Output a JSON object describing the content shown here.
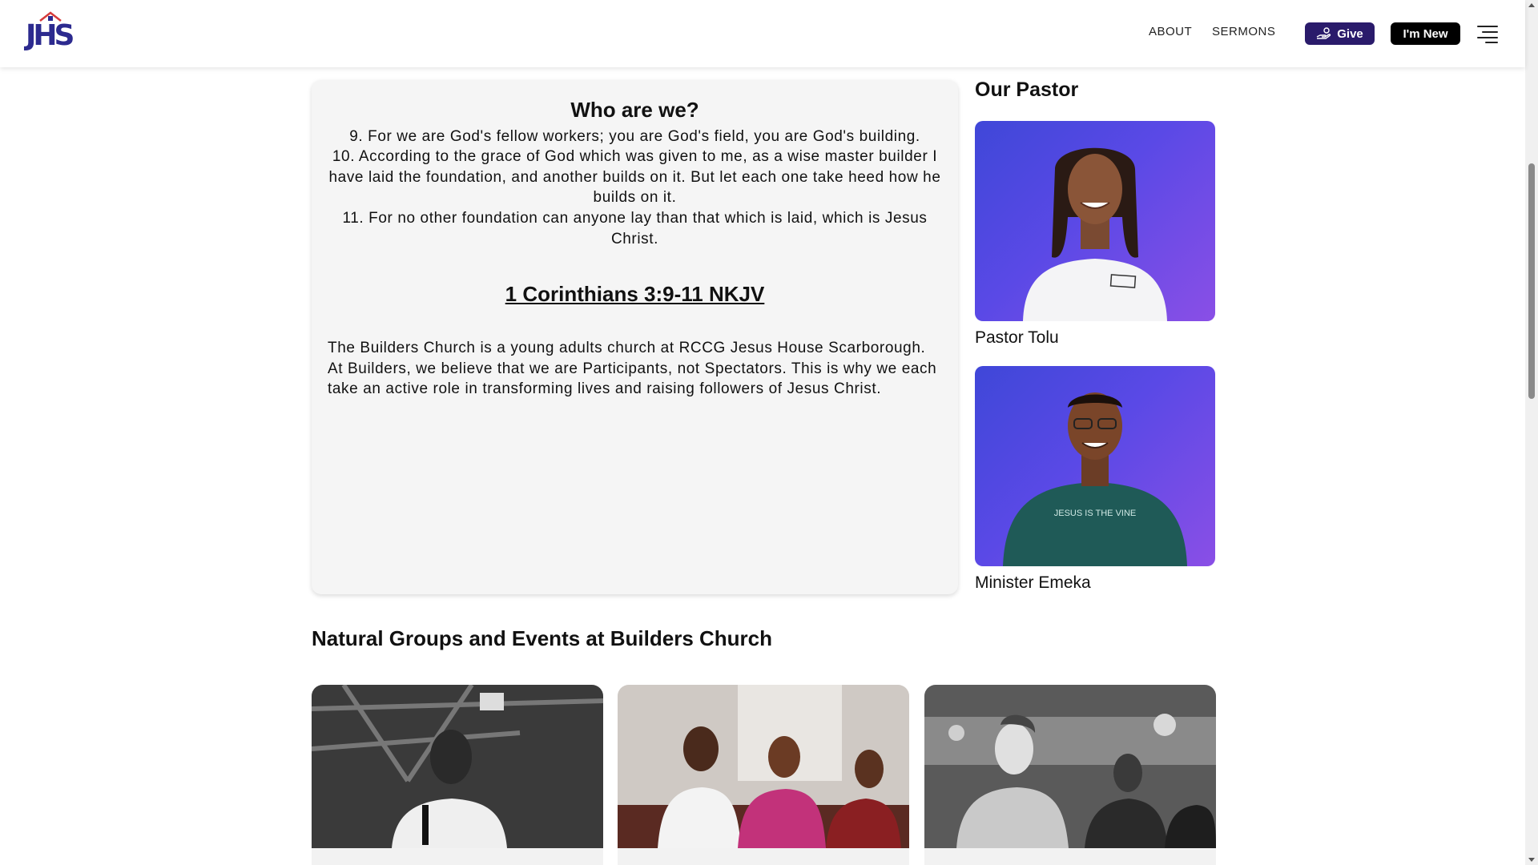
{
  "header": {
    "logo_text": "JHS",
    "nav": {
      "about": "ABOUT",
      "sermons": "SERMONS"
    },
    "give_label": "Give",
    "new_label": "I'm New"
  },
  "who": {
    "title": "Who are we?",
    "verses": [
      "9. For we are God's fellow workers; you are God's field, you are God's building.",
      "10. According to the grace of God which was given to me, as a wise master builder I have laid the foundation, and another builds on it. But let each one take heed how he builds on it.",
      "11. For no other foundation can anyone lay than that which is laid, which is Jesus Christ."
    ],
    "reference": "1 Corinthians 3:9-11 NKJV",
    "description": "The Builders Church is a young adults church at RCCG Jesus House Scarborough. At Builders, we believe that we are Participants, not Spectators. This is why we each take an active role in transforming lives and raising followers of Jesus Christ."
  },
  "pastors": {
    "heading": "Our Pastor",
    "people": [
      {
        "name": "Pastor Tolu"
      },
      {
        "name": "Minister Emeka",
        "shirt_text": "JESUS IS THE VINE"
      }
    ]
  },
  "groups": {
    "heading": "Natural Groups and Events at Builders Church"
  },
  "colors": {
    "give_button": "#2a1b6b",
    "logo": "#2c2a8f",
    "card_background": "#f5f5f5",
    "photo_purple": "#5a49e6"
  }
}
